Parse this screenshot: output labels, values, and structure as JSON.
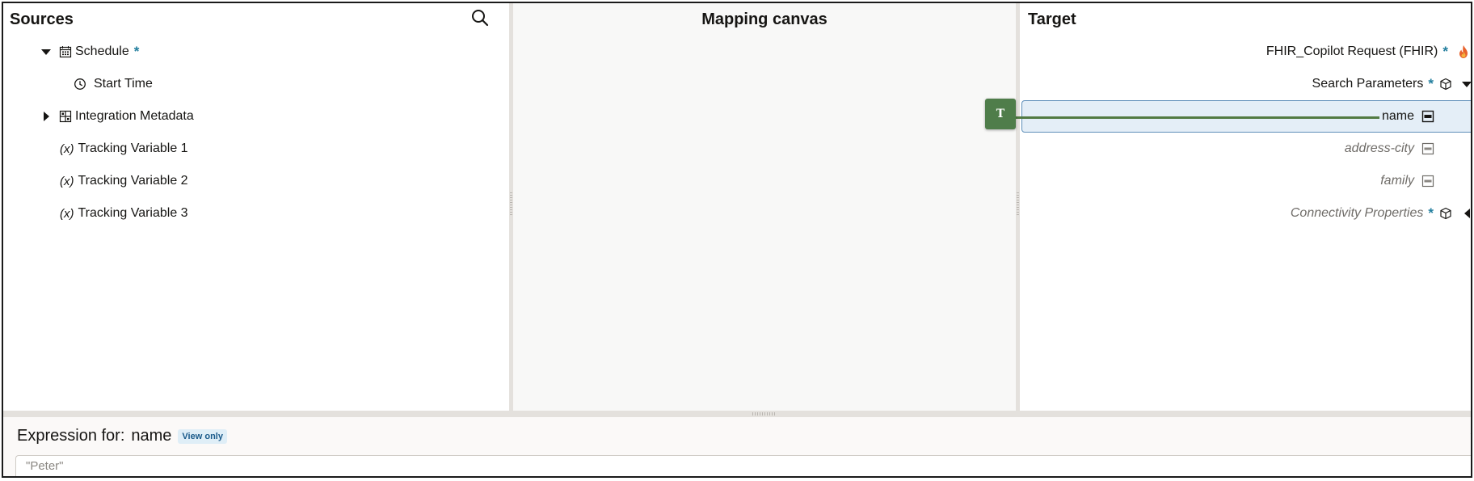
{
  "sources": {
    "title": "Sources",
    "items": [
      {
        "label": "Schedule",
        "required": "*"
      },
      {
        "label": "Start Time"
      },
      {
        "label": "Integration Metadata"
      },
      {
        "prefix": "(x)",
        "label": "Tracking Variable 1"
      },
      {
        "prefix": "(x)",
        "label": "Tracking Variable 2"
      },
      {
        "prefix": "(x)",
        "label": "Tracking Variable 3"
      }
    ]
  },
  "canvas": {
    "title": "Mapping canvas",
    "mapping_node": {
      "label": "T",
      "color": "#4f7d4a"
    },
    "line_color": "#527a43"
  },
  "target": {
    "title": "Target",
    "items": [
      {
        "label": "FHIR_Copilot Request (FHIR)",
        "required": "*"
      },
      {
        "label": "Search Parameters",
        "required": "*"
      },
      {
        "label": "name"
      },
      {
        "label": "address-city"
      },
      {
        "label": "family"
      },
      {
        "label": "Connectivity Properties",
        "required": "*"
      }
    ]
  },
  "expression": {
    "label": "Expression for:",
    "field": "name",
    "badge": "View only",
    "value": "\"Peter\""
  },
  "colors": {
    "required": "#227e9e",
    "selection_bg": "#e4eef7",
    "selection_border": "#5f8fb9"
  }
}
